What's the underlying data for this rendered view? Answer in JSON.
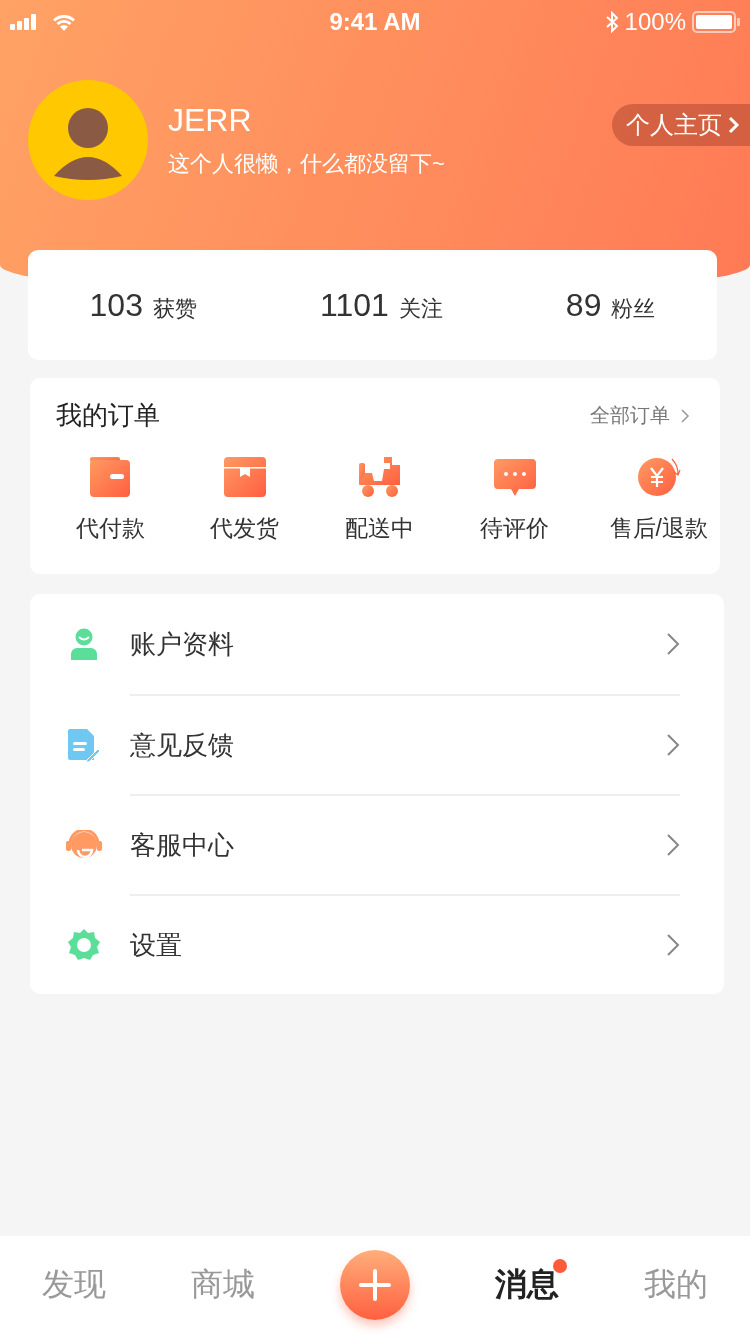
{
  "status_bar": {
    "time": "9:41 AM",
    "battery": "100%"
  },
  "profile": {
    "name": "JERR",
    "bio": "这个人很懒，什么都没留下~",
    "homepage_link": "个人主页"
  },
  "stats": [
    {
      "value": "103",
      "label": "获赞"
    },
    {
      "value": "1101",
      "label": "关注"
    },
    {
      "value": "89",
      "label": "粉丝"
    }
  ],
  "orders": {
    "title": "我的订单",
    "all_link": "全部订单",
    "items": [
      {
        "label": "代付款",
        "kind": "wallet"
      },
      {
        "label": "代发货",
        "kind": "box"
      },
      {
        "label": "配送中",
        "kind": "scooter"
      },
      {
        "label": "待评价",
        "kind": "comment"
      },
      {
        "label": "售后/退款",
        "kind": "refund"
      }
    ]
  },
  "menu": [
    {
      "label": "账户资料",
      "kind": "user"
    },
    {
      "label": "意见反馈",
      "kind": "feedback"
    },
    {
      "label": "客服中心",
      "kind": "support"
    },
    {
      "label": "设置",
      "kind": "settings"
    }
  ],
  "tabs": [
    {
      "kind": "text",
      "label": "发现",
      "selected": false,
      "badge": false
    },
    {
      "kind": "text",
      "label": "商城",
      "selected": false,
      "badge": false
    },
    {
      "kind": "add"
    },
    {
      "kind": "text",
      "label": "消息",
      "selected": true,
      "badge": true
    },
    {
      "kind": "text",
      "label": "我的",
      "selected": false,
      "badge": false
    }
  ]
}
